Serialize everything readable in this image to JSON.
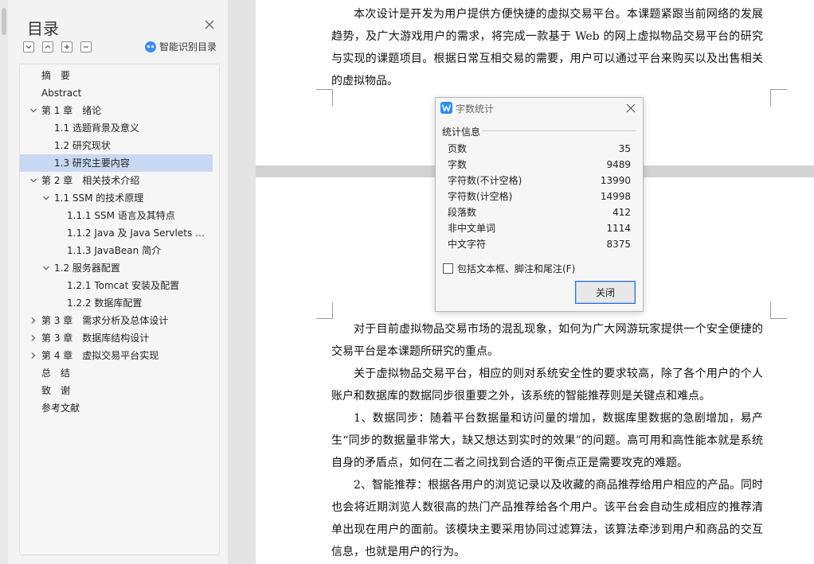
{
  "toc": {
    "title": "目录",
    "smart_label": "智能识别目录",
    "items": [
      {
        "label": "摘　要"
      },
      {
        "label": "Abstract"
      },
      {
        "label": "第 1 章　绪论"
      },
      {
        "label": "1.1 选题背景及意义"
      },
      {
        "label": "1.2 研究现状"
      },
      {
        "label": "1.3 研究主要内容"
      },
      {
        "label": "第 2 章　相关技术介绍"
      },
      {
        "label": "1.1 SSM 的技术原理"
      },
      {
        "label": "1.1.1 SSM 语言及其特点"
      },
      {
        "label": "1.1.2 Java 及 Java Servlets 概..."
      },
      {
        "label": "1.1.3 JavaBean 简介"
      },
      {
        "label": "1.2 服务器配置"
      },
      {
        "label": "1.2.1 Tomcat 安装及配置"
      },
      {
        "label": "1.2.2  数据库配置"
      },
      {
        "label": "第 3 章　需求分析及总体设计"
      },
      {
        "label": "第 3 章　数据库结构设计"
      },
      {
        "label": "第 4 章　虚拟交易平台实现"
      },
      {
        "label": "总　结"
      },
      {
        "label": "致　谢"
      },
      {
        "label": "参考文献"
      }
    ]
  },
  "document": {
    "paragraphs": [
      "本次设计是开发为用户提供方便快捷的虚拟交易平台。本课题紧跟当前网络的发展趋势，及广大游戏用户的需求，将完成一款基于 Web 的网上虚拟物品交易平台的研究与实现的课题项目。根据日常互相交易的需要，用户可以通过平台来购买以及出售相关的虚拟物品。",
      "对于目前虚拟物品交易市场的混乱现象，如何为广大网游玩家提供一个安全便捷的交易平台是本课题所研究的重点。",
      "关于虚拟物品交易平台，相应的则对系统安全性的要求较高，除了各个用户的个人账户和数据库的数据同步很重要之外，该系统的智能推荐则是关键点和难点。",
      "1、数据同步：随着平台数据量和访问量的增加，数据库里数据的急剧增加，易产生“同步的数据量非常大，缺又想达到实时的效果”的问题。高可用和高性能本就是系统自身的矛盾点，如何在二者之间找到合适的平衡点正是需要攻克的难题。",
      "2、智能推荐：根据各用户的浏览记录以及收藏的商品推荐给用户相应的产品。同时也会将近期浏览人数很高的热门产品推荐给各个用户。该平台会自动生成相应的推荐清单出现在用户的面前。该模块主要采用协同过滤算法，该算法牵涉到用户和商品的交互信息，也就是用户的行为。"
    ]
  },
  "dialog": {
    "title": "字数统计",
    "group_label": "统计信息",
    "stats": [
      {
        "label": "页数",
        "value": "35"
      },
      {
        "label": "字数",
        "value": "9489"
      },
      {
        "label": "字符数(不计空格)",
        "value": "13990"
      },
      {
        "label": "字符数(计空格)",
        "value": "14998"
      },
      {
        "label": "段落数",
        "value": "412"
      },
      {
        "label": "非中文单词",
        "value": "1114"
      },
      {
        "label": "中文字符",
        "value": "8375"
      }
    ],
    "checkbox_label": "包括文本框、脚注和尾注(F)",
    "close_button": "关闭"
  },
  "colors": {
    "selected_bg": "#c9d8f2",
    "accent": "#2d8cf0"
  }
}
